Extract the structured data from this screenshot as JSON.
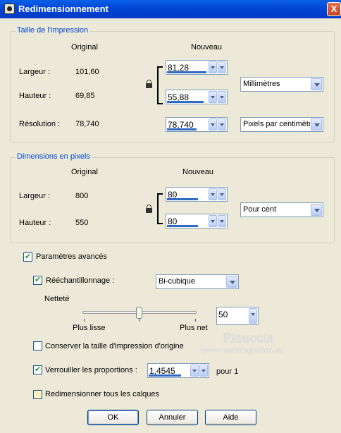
{
  "window": {
    "title": "Redimensionnement",
    "close": "X"
  },
  "print_size": {
    "group_title": "Taille de l'impression",
    "col_original": "Original",
    "col_new": "Nouveau",
    "width_label": "Largeur :",
    "width_original": "101,60",
    "width_new": "81,28",
    "height_label": "Hauteur :",
    "height_original": "69,85",
    "height_new": "55,88",
    "units": "Millimètres",
    "resolution_label": "Résolution :",
    "resolution_original": "78,740",
    "resolution_new": "78,740",
    "resolution_units": "Pixels par centimètre"
  },
  "pixel_dims": {
    "group_title": "Dimensions en pixels",
    "col_original": "Original",
    "col_new": "Nouveau",
    "width_label": "Largeur :",
    "width_original": "800",
    "width_new": "80",
    "height_label": "Hauteur :",
    "height_original": "550",
    "height_new": "80",
    "units": "Pour cent"
  },
  "advanced": {
    "advanced_label": "Paramètres avancés",
    "advanced_checked": true,
    "resample_label": "Rééchantillonnage :",
    "resample_checked": true,
    "resample_method": "Bi-cubique",
    "sharpness_label": "Netteté",
    "sharpness_value": "50",
    "slider_min_label": "Plus lisse",
    "slider_max_label": "Plus net",
    "keep_print_size_label": "Conserver la taille d'impression d'origine",
    "keep_print_size_checked": false,
    "lock_ratio_label": "Verrouiller les proportions :",
    "lock_ratio_checked": true,
    "ratio_value": "1,4545",
    "ratio_suffix": "pour 1",
    "resize_all_layers_label": "Redimensionner tous les calques",
    "resize_all_layers_checked": false
  },
  "watermark": {
    "line1": "Pinuccia",
    "line2": "www.maidiregrafica.eu"
  },
  "buttons": {
    "ok": "OK",
    "cancel": "Annuler",
    "help": "Aide"
  }
}
